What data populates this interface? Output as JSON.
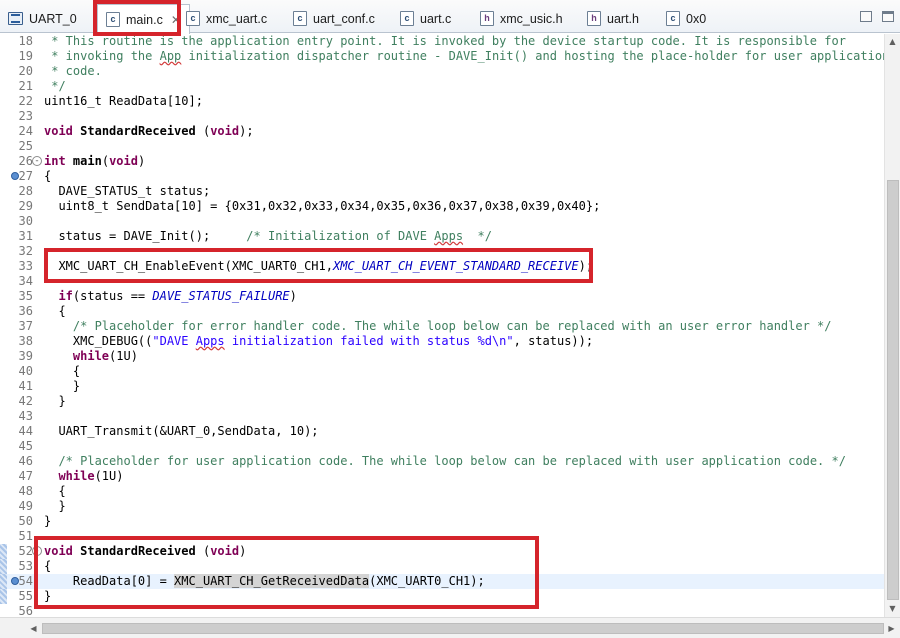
{
  "tabs": [
    {
      "label": "UART_0",
      "icon": "app-config-icon",
      "active": false
    },
    {
      "label": "main.c",
      "icon": "c-file-icon",
      "active": true
    },
    {
      "label": "xmc_uart.c",
      "icon": "c-file-icon",
      "active": false
    },
    {
      "label": "uart_conf.c",
      "icon": "c-file-icon",
      "active": false
    },
    {
      "label": "uart.c",
      "icon": "c-file-icon",
      "active": false
    },
    {
      "label": "xmc_usic.h",
      "icon": "h-file-icon",
      "active": false
    },
    {
      "label": "uart.h",
      "icon": "h-file-icon",
      "active": false
    },
    {
      "label": "0x0",
      "icon": "c-file-icon",
      "active": false
    }
  ],
  "editor": {
    "lines": [
      {
        "n": "18",
        "segs": [
          [
            "cm",
            " * This routine is the application entry point. It is invoked by the device startup code. It is responsible for"
          ]
        ]
      },
      {
        "n": "19",
        "segs": [
          [
            "cm",
            " * invoking the "
          ],
          [
            "cm wave",
            "App"
          ],
          [
            "cm",
            " initialization dispatcher routine - DAVE_Init() and hosting the place-holder for user application"
          ]
        ]
      },
      {
        "n": "20",
        "segs": [
          [
            "cm",
            " * code."
          ]
        ]
      },
      {
        "n": "21",
        "segs": [
          [
            "cm",
            " */"
          ]
        ]
      },
      {
        "n": "22",
        "segs": [
          [
            "",
            "uint16_t ReadData[10];"
          ]
        ]
      },
      {
        "n": "23",
        "segs": []
      },
      {
        "n": "24",
        "segs": [
          [
            "kw",
            "void"
          ],
          [
            "",
            " "
          ],
          [
            "fn",
            "StandardReceived"
          ],
          [
            "",
            " ("
          ],
          [
            "kw",
            "void"
          ],
          [
            "",
            ");"
          ]
        ]
      },
      {
        "n": "25",
        "segs": []
      },
      {
        "n": "26",
        "fold": "-",
        "segs": [
          [
            "kw",
            "int"
          ],
          [
            "",
            " "
          ],
          [
            "fn",
            "main"
          ],
          [
            "",
            "("
          ],
          [
            "kw",
            "void"
          ],
          [
            "",
            ")"
          ]
        ]
      },
      {
        "n": "27",
        "mark": true,
        "segs": [
          [
            "",
            "{"
          ]
        ]
      },
      {
        "n": "28",
        "segs": [
          [
            "",
            "  DAVE_STATUS_t status;"
          ]
        ]
      },
      {
        "n": "29",
        "segs": [
          [
            "",
            "  uint8_t SendData[10] = {0x31,0x32,0x33,0x34,0x35,0x36,0x37,0x38,0x39,0x40};"
          ]
        ]
      },
      {
        "n": "30",
        "segs": []
      },
      {
        "n": "31",
        "segs": [
          [
            "",
            "  status = DAVE_Init();     "
          ],
          [
            "cm",
            "/* Initialization of DAVE "
          ],
          [
            "cm wave",
            "Apps"
          ],
          [
            "cm",
            "  */"
          ]
        ]
      },
      {
        "n": "32",
        "segs": []
      },
      {
        "n": "33",
        "segs": [
          [
            "",
            "  XMC_UART_CH_EnableEvent(XMC_UART0_CH1,"
          ],
          [
            "en",
            "XMC_UART_CH_EVENT_STANDARD_RECEIVE"
          ],
          [
            "",
            ");"
          ]
        ]
      },
      {
        "n": "34",
        "segs": []
      },
      {
        "n": "35",
        "segs": [
          [
            "",
            "  "
          ],
          [
            "kw",
            "if"
          ],
          [
            "",
            "(status == "
          ],
          [
            "en",
            "DAVE_STATUS_FAILURE"
          ],
          [
            "",
            ")"
          ]
        ]
      },
      {
        "n": "36",
        "segs": [
          [
            "",
            "  {"
          ]
        ]
      },
      {
        "n": "37",
        "segs": [
          [
            "",
            "    "
          ],
          [
            "cm",
            "/* Placeholder for error handler code. The while loop below can be replaced with an user error handler */"
          ]
        ]
      },
      {
        "n": "38",
        "segs": [
          [
            "",
            "    XMC_DEBUG(("
          ],
          [
            "str",
            "\"DAVE "
          ],
          [
            "str wave",
            "Apps"
          ],
          [
            "str",
            " initialization failed with status %d\\n\""
          ],
          [
            "",
            ", status));"
          ]
        ]
      },
      {
        "n": "39",
        "segs": [
          [
            "",
            "    "
          ],
          [
            "kw",
            "while"
          ],
          [
            "",
            "(1U)"
          ]
        ]
      },
      {
        "n": "40",
        "segs": [
          [
            "",
            "    {"
          ]
        ]
      },
      {
        "n": "41",
        "segs": [
          [
            "",
            "    }"
          ]
        ]
      },
      {
        "n": "42",
        "segs": [
          [
            "",
            "  }"
          ]
        ]
      },
      {
        "n": "43",
        "segs": []
      },
      {
        "n": "44",
        "segs": [
          [
            "",
            "  UART_Transmit(&UART_0,SendData, 10);"
          ]
        ]
      },
      {
        "n": "45",
        "segs": []
      },
      {
        "n": "46",
        "segs": [
          [
            "",
            "  "
          ],
          [
            "cm",
            "/* Placeholder for user application code. The while loop below can be replaced with user application code. */"
          ]
        ]
      },
      {
        "n": "47",
        "segs": [
          [
            "",
            "  "
          ],
          [
            "kw",
            "while"
          ],
          [
            "",
            "(1U)"
          ]
        ]
      },
      {
        "n": "48",
        "segs": [
          [
            "",
            "  {"
          ]
        ]
      },
      {
        "n": "49",
        "segs": [
          [
            "",
            "  }"
          ]
        ]
      },
      {
        "n": "50",
        "segs": [
          [
            "",
            "}"
          ]
        ]
      },
      {
        "n": "51",
        "segs": []
      },
      {
        "n": "52",
        "fold": "-",
        "changed": true,
        "segs": [
          [
            "kw",
            "void"
          ],
          [
            "",
            " "
          ],
          [
            "fn",
            "StandardReceived"
          ],
          [
            "",
            " ("
          ],
          [
            "kw",
            "void"
          ],
          [
            "",
            ")"
          ]
        ]
      },
      {
        "n": "53",
        "changed": true,
        "segs": [
          [
            "",
            "{"
          ]
        ]
      },
      {
        "n": "54",
        "changed": true,
        "mark": true,
        "current": true,
        "segs": [
          [
            "",
            "    ReadData[0] = "
          ],
          [
            "occ",
            "XMC_UART_CH_GetReceivedData"
          ],
          [
            "",
            "(XMC_UART0_CH1);"
          ]
        ]
      },
      {
        "n": "55",
        "changed": true,
        "segs": [
          [
            "",
            "}"
          ]
        ]
      },
      {
        "n": "56",
        "segs": []
      }
    ]
  }
}
